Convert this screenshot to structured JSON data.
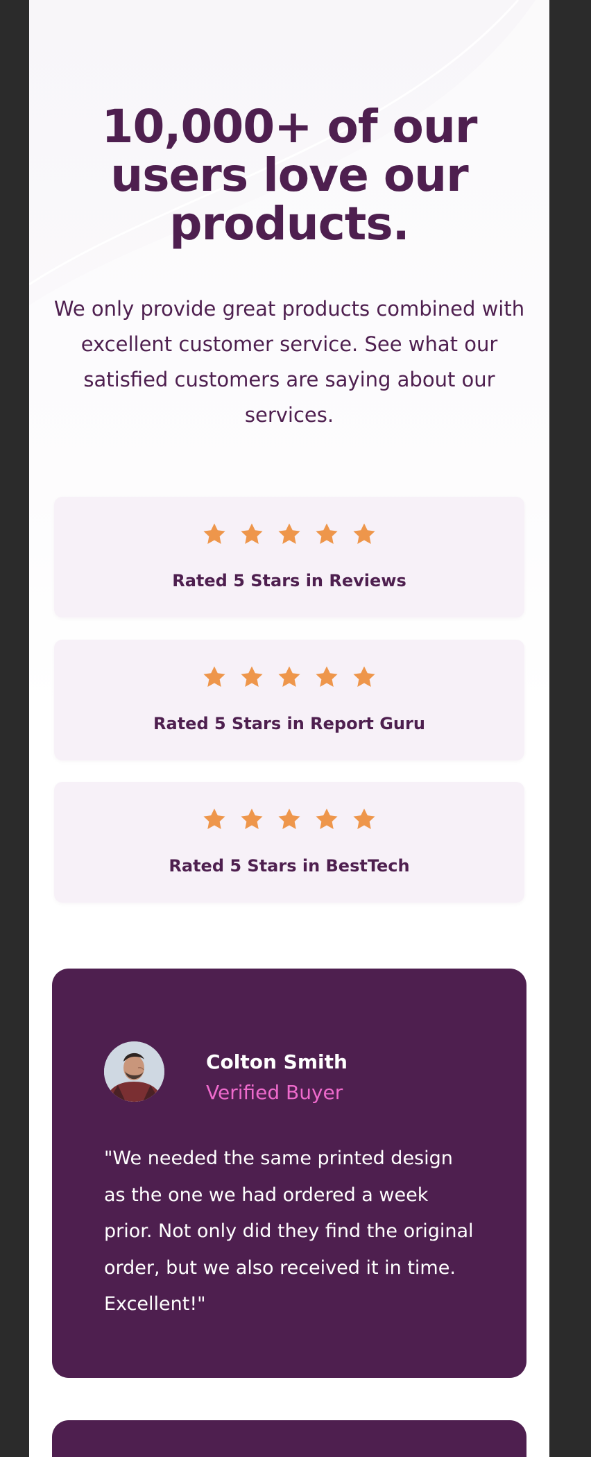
{
  "hero": {
    "headline": "10,000+ of our users love our products.",
    "intro": "We only provide great products combined with excellent customer service. See what our satisfied customers are saying about our services."
  },
  "ratings": [
    {
      "label": "Rated 5 Stars in Reviews",
      "stars": 5
    },
    {
      "label": "Rated 5 Stars in Report Guru",
      "stars": 5
    },
    {
      "label": "Rated 5 Stars in BestTech",
      "stars": 5
    }
  ],
  "testimonials": [
    {
      "name": "Colton Smith",
      "status": "Verified Buyer",
      "quote": "\"We needed the same printed design as the one we had ordered a week prior. Not only did they find the original order, but we also received it in time. Excellent!\"",
      "avatar_icon": "avatar-photo"
    }
  ],
  "icons": {
    "star": "star-icon"
  },
  "colors": {
    "page_bg": "#2b2b2b",
    "content_bg": "#ffffff",
    "primary_text": "#4e1f4f",
    "card_bg": "#f7f1f8",
    "star": "#ee964b",
    "testimonial_bg": "#4e1f4f",
    "accent": "#ee6acc",
    "white": "#ffffff"
  }
}
